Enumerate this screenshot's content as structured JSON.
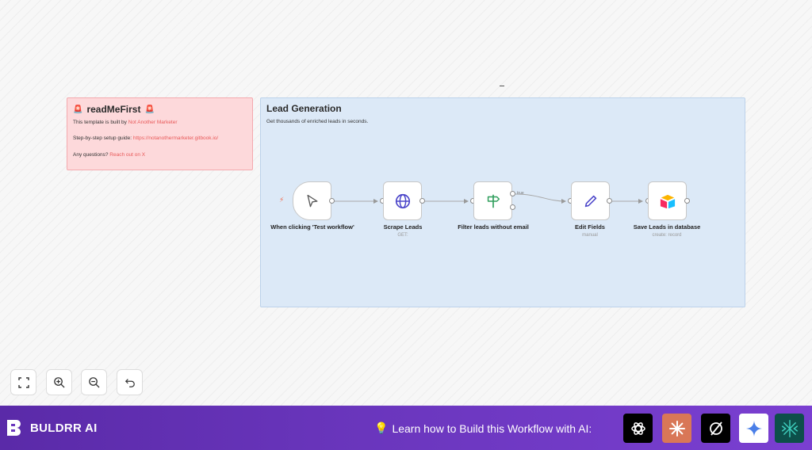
{
  "readme": {
    "title": "readMeFirst",
    "line1_prefix": "This template is built by ",
    "line1_link": "Not Another Marketer",
    "line2_prefix": "Step-by-step setup guide: ",
    "line2_link": "https://notanothermarketer.gitbook.io/",
    "line3_prefix": "Any questions? ",
    "line3_link": "Reach out on X"
  },
  "group": {
    "title": "Lead Generation",
    "description": "Get thousands of enriched leads in seconds."
  },
  "nodes": [
    {
      "label": "When clicking 'Test workflow'",
      "sub": "",
      "icon": "cursor-icon"
    },
    {
      "label": "Scrape Leads",
      "sub": "GET:",
      "icon": "globe-icon"
    },
    {
      "label": "Filter leads without email",
      "sub": "",
      "icon": "signpost-icon"
    },
    {
      "label": "Edit Fields",
      "sub": "manual",
      "icon": "pencil-icon"
    },
    {
      "label": "Save Leads in database",
      "sub": "create: record",
      "icon": "airtable-icon"
    }
  ],
  "filter_branch_true": "true",
  "controls": [
    "fit-view-icon",
    "zoom-in-icon",
    "zoom-out-icon",
    "undo-icon"
  ],
  "bottom_bar": {
    "brand": "BULDRR AI",
    "cta": "Learn how to Build this Workflow with AI:",
    "ai_buttons": [
      "chatgpt-icon",
      "claude-icon",
      "perplexity-icon",
      "gemini-icon",
      "deepseek-icon"
    ]
  },
  "colors": {
    "accent": "#e85a5a",
    "bar": "#6a36bd",
    "note_red": "#fdd9db",
    "note_blue": "#dce9f7"
  }
}
